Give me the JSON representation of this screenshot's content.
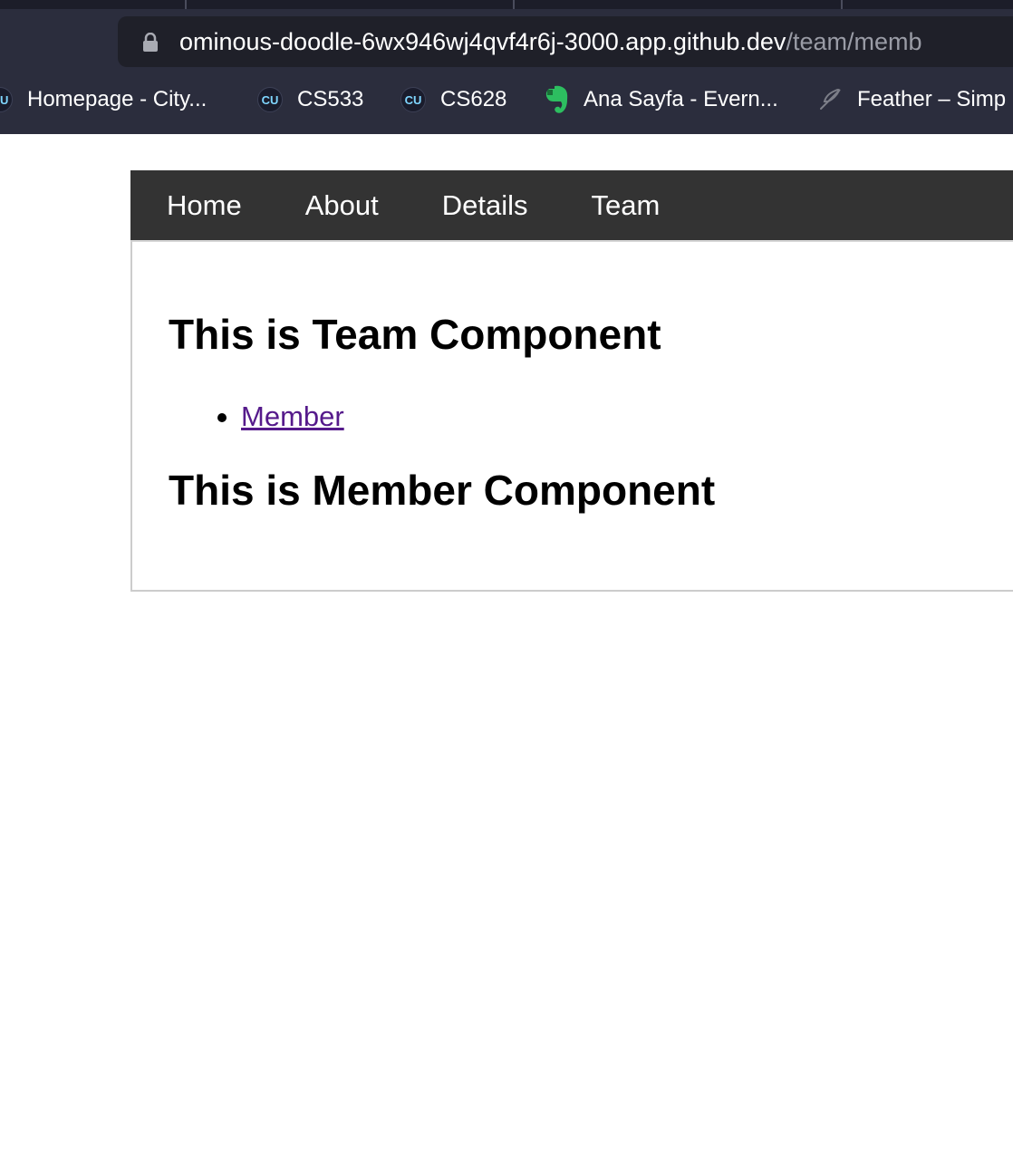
{
  "browser": {
    "url_host": "ominous-doodle-6wx946wj4qvf4r6j-3000.app.github.dev",
    "url_path": "/team/memb",
    "bookmarks": [
      {
        "label": "Homepage - City...",
        "icon": "cu-logo-icon",
        "icon_text": "CU"
      },
      {
        "label": "CS533",
        "icon": "cu-logo-icon",
        "icon_text": "CU"
      },
      {
        "label": "CS628",
        "icon": "cu-logo-icon",
        "icon_text": "CU"
      },
      {
        "label": "Ana Sayfa - Evern...",
        "icon": "evernote-icon"
      },
      {
        "label": "Feather – Simp",
        "icon": "feather-icon"
      }
    ]
  },
  "nav": {
    "links": [
      "Home",
      "About",
      "Details",
      "Team"
    ]
  },
  "team": {
    "heading": "This is Team Component",
    "links": [
      "Member"
    ]
  },
  "member": {
    "heading": "This is Member Component"
  },
  "colors": {
    "nav_bg": "#333333",
    "visited_link": "#551a8b",
    "chrome_bg": "#2b2d3d"
  }
}
